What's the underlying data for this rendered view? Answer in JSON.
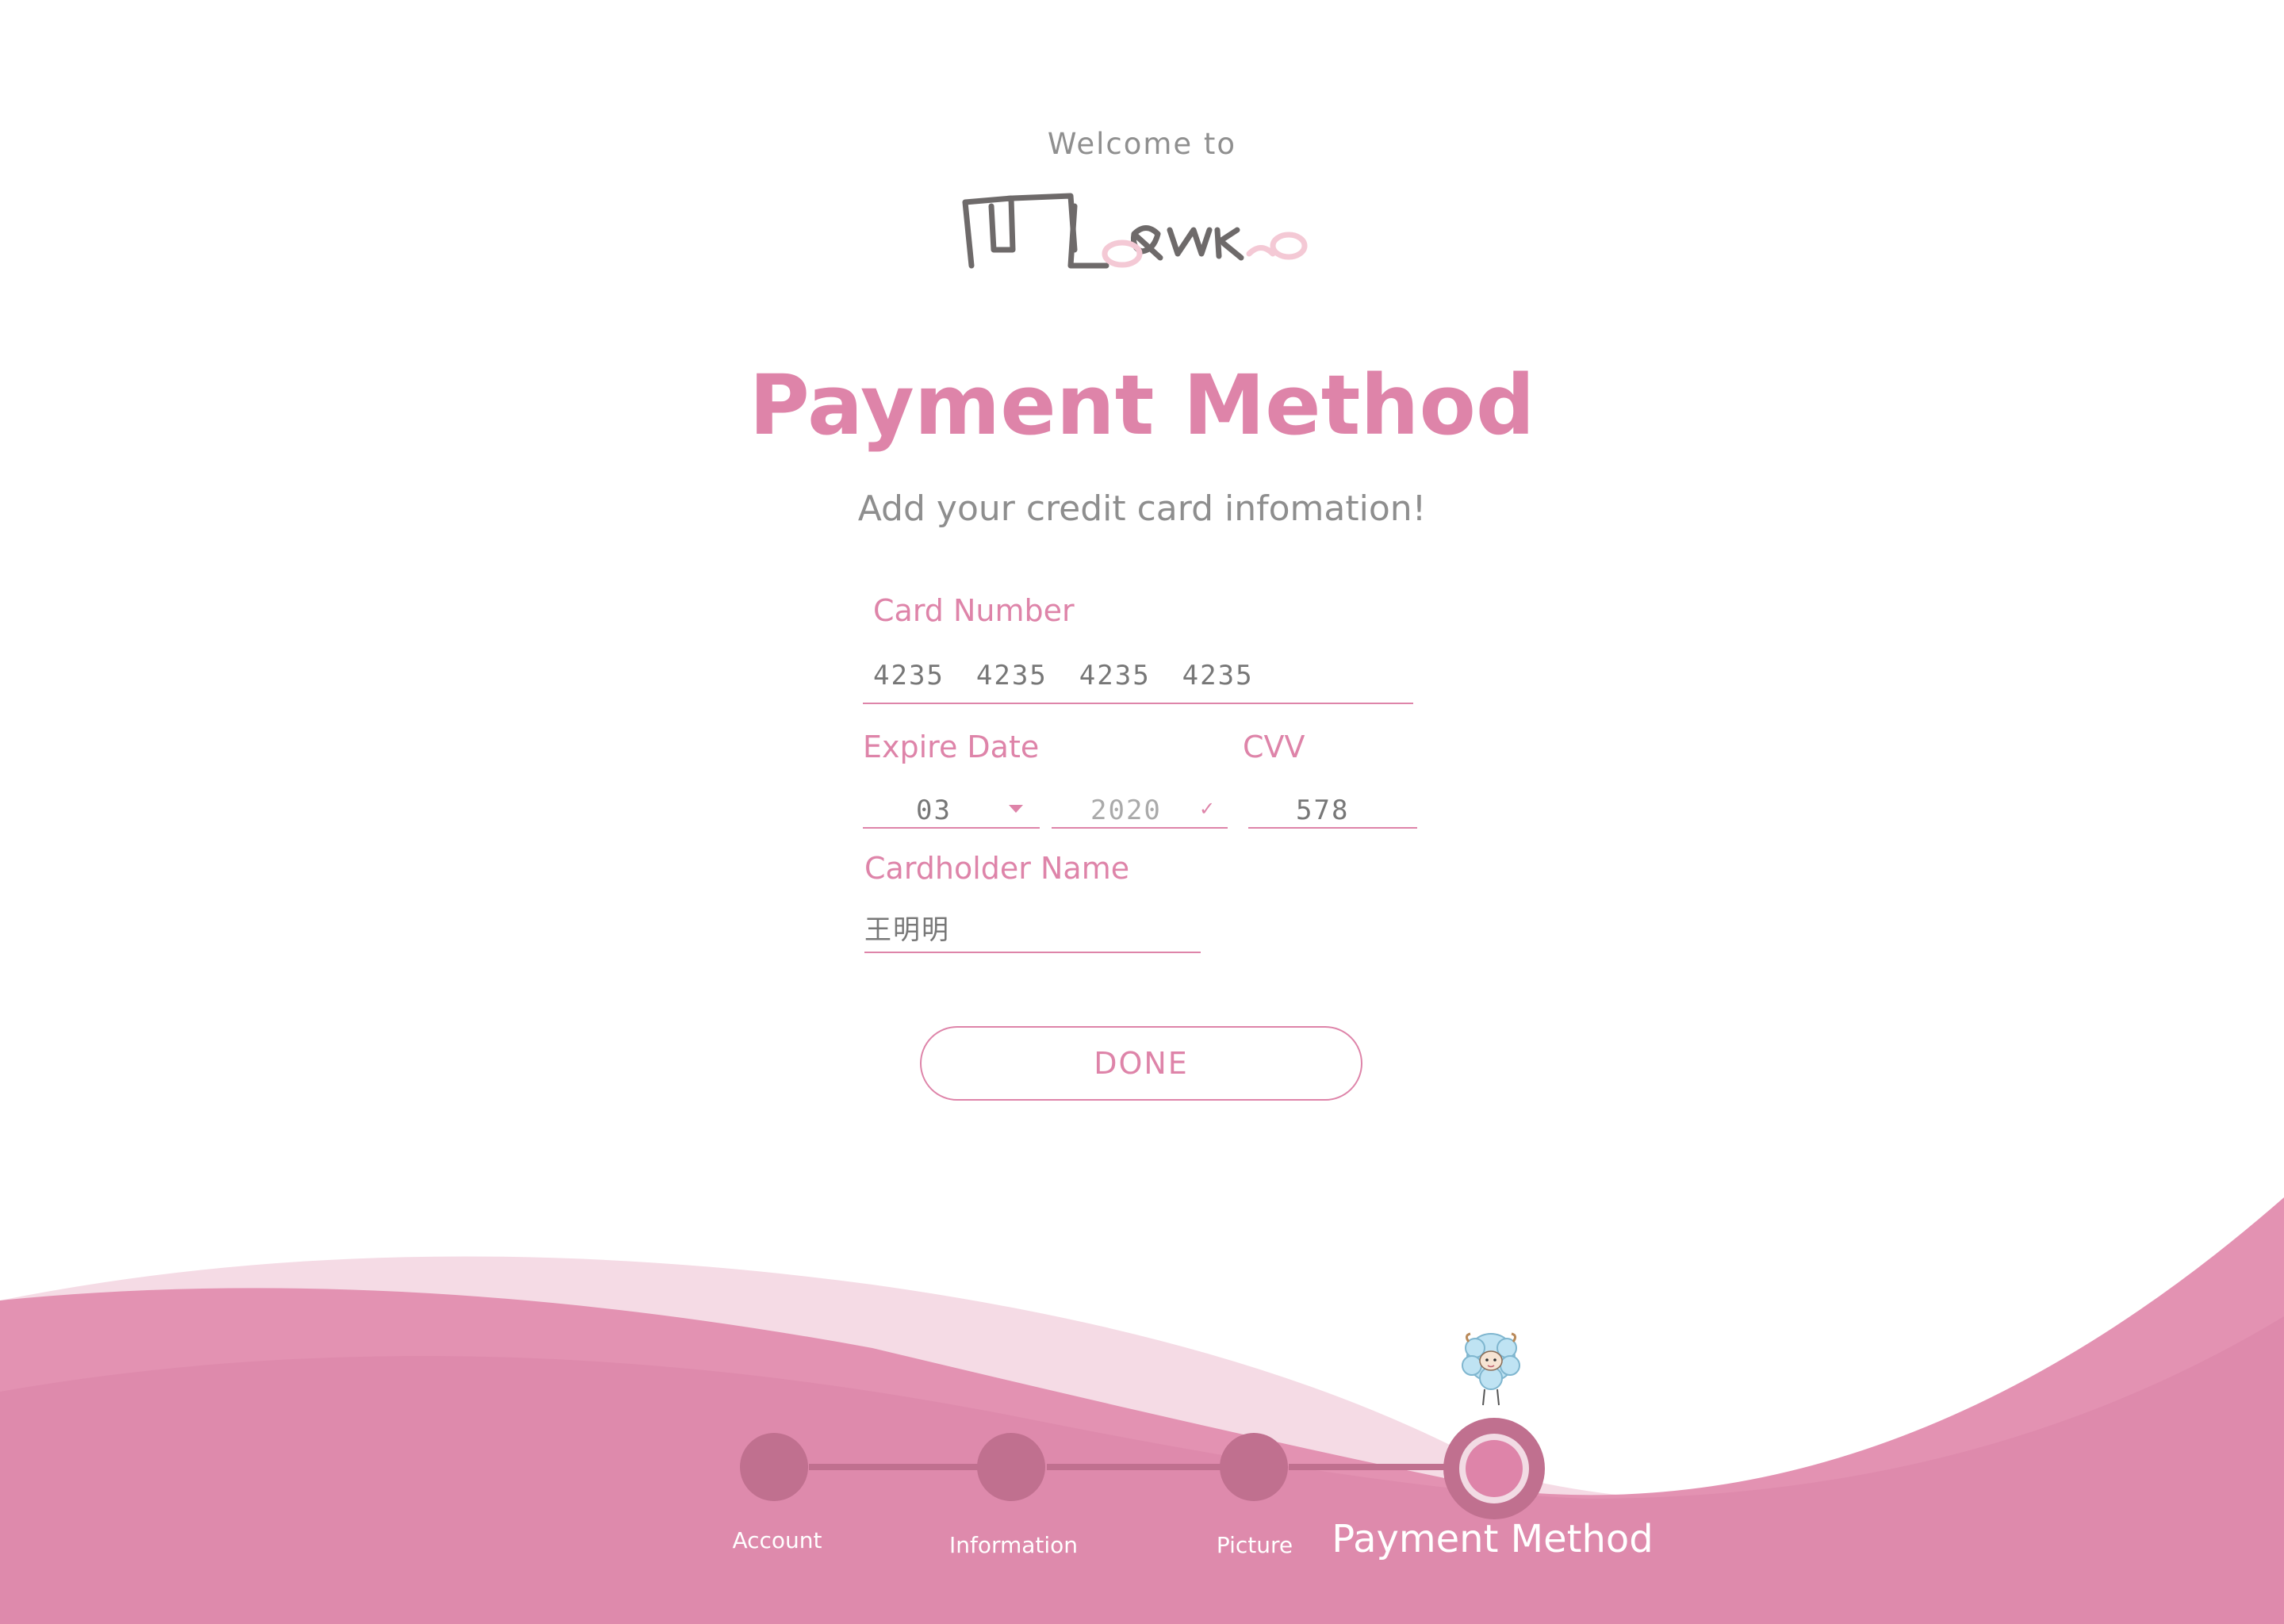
{
  "header": {
    "welcome": "Welcome to",
    "logo_text": "Marako"
  },
  "page": {
    "title": "Payment Method",
    "subtitle": "Add your credit card infomation!"
  },
  "form": {
    "card_number": {
      "label": "Card Number",
      "groups": [
        "4235",
        "4235",
        "4235",
        "4235"
      ]
    },
    "expire_date": {
      "label": "Expire Date",
      "month": "03",
      "year": "2020"
    },
    "cvv": {
      "label": "CVV",
      "value": "578"
    },
    "cardholder": {
      "label": "Cardholder Name",
      "value": "王明明"
    },
    "done_label": "DONE"
  },
  "stepper": {
    "steps": [
      {
        "label": "Account",
        "state": "done"
      },
      {
        "label": "Information",
        "state": "done"
      },
      {
        "label": "Picture",
        "state": "done"
      },
      {
        "label": "Payment Method",
        "state": "active"
      }
    ]
  },
  "colors": {
    "accent": "#de84a9",
    "step_dot": "#c0708f",
    "wave_light": "#f5dbe5",
    "wave_mid": "#e38fb0",
    "wave_main": "#de8aac",
    "text_gray": "#8e8e8e"
  },
  "icons": {
    "month_dropdown": "caret-down-icon",
    "year_dropdown": "check-icon",
    "mascot": "sheep-mascot"
  }
}
